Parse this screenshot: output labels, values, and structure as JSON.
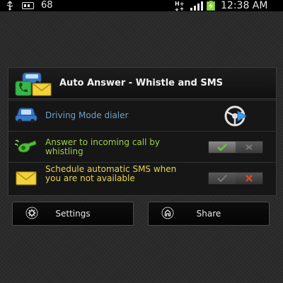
{
  "status_bar": {
    "battery_percent": "68",
    "network": "H+",
    "time": "12:38 AM",
    "icons": [
      "usb-icon",
      "sd-card-icon",
      "hplus-network-icon",
      "signal-icon",
      "battery-charging-icon"
    ]
  },
  "app": {
    "title": "Auto Answer - Whistle and SMS",
    "icon": "app-car-sms-icon"
  },
  "options": [
    {
      "label": "Driving Mode dialer",
      "icon": "car-icon",
      "control": "play-wheel-button"
    },
    {
      "label": "Answer to incoming call by whistling",
      "icon": "whistle-icon",
      "control": "toggle",
      "state": "on"
    },
    {
      "label": "Schedule automatic SMS when you are not available",
      "icon": "envelope-icon",
      "control": "toggle",
      "state": "off"
    }
  ],
  "buttons": {
    "settings_label": "Settings",
    "share_label": "Share"
  },
  "colors": {
    "label_blue": "#6f9fc4",
    "label_green": "#9ccf4f",
    "label_yellow": "#e7d44f",
    "toggle_on": "#6cc431",
    "toggle_off": "#d24a2a"
  }
}
